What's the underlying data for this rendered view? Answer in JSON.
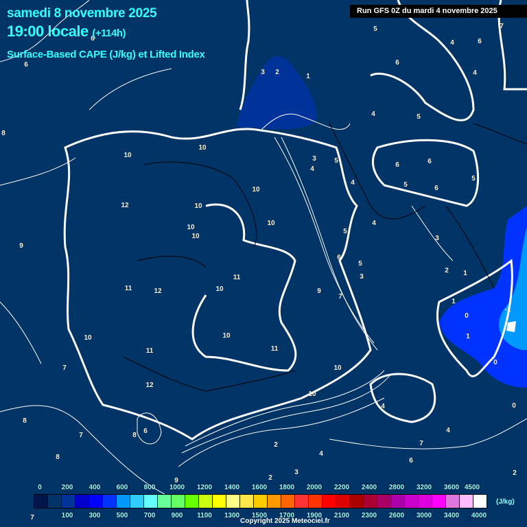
{
  "header": {
    "date": "samedi 8 novembre 2025",
    "time": "19:00 locale",
    "lead": "(+114h)",
    "title": "Surface-Based CAPE (J/kg) et Lifted Index",
    "run": "Run GFS 0Z du mardi 4 novembre 2025"
  },
  "legend": {
    "unit": "(J/kg)",
    "colors": [
      "#00164a",
      "#003366",
      "#003399",
      "#0000cc",
      "#0000ff",
      "#0033ff",
      "#0099ff",
      "#33ccff",
      "#66ffff",
      "#66ff99",
      "#66ff66",
      "#66ff00",
      "#ccff11",
      "#ffff00",
      "#ffff88",
      "#ffe64d",
      "#ffcc00",
      "#ff9900",
      "#ff6600",
      "#ff3333",
      "#ff3300",
      "#ff0000",
      "#dd0000",
      "#aa0000",
      "#aa0033",
      "#aa0066",
      "#aa00aa",
      "#cc00cc",
      "#dd00dd",
      "#ff00ff",
      "#dd77dd",
      "#ffbbff",
      "#ffffff"
    ],
    "top_labels": [
      "0",
      "200",
      "400",
      "600",
      "800",
      "1000",
      "1200",
      "1400",
      "1600",
      "1800",
      "2000",
      "2200",
      "2400",
      "2800",
      "3200",
      "3600",
      "4500"
    ],
    "bottom_labels": [
      "100",
      "300",
      "500",
      "700",
      "900",
      "1100",
      "1300",
      "1500",
      "1700",
      "1900",
      "2100",
      "2300",
      "2600",
      "3000",
      "3400",
      "4000"
    ]
  },
  "lifted_index_labels": [
    "6",
    "6",
    "8",
    "10",
    "10",
    "12",
    "10",
    "10",
    "10",
    "10",
    "10",
    "9",
    "11",
    "12",
    "11",
    "10",
    "10",
    "10",
    "11",
    "11",
    "7",
    "12",
    "10",
    "10",
    "8",
    "7",
    "8",
    "6",
    "8",
    "9",
    "2",
    "2",
    "3",
    "4",
    "6",
    "7",
    "4",
    "4",
    "0",
    "0",
    "1",
    "0",
    "1",
    "1",
    "-1",
    "2",
    "3",
    "4",
    "5",
    "6",
    "5",
    "3",
    "7",
    "9",
    "4",
    "5",
    "3",
    "4",
    "6",
    "6",
    "5",
    "6",
    "5",
    "4",
    "5",
    "6",
    "4",
    "4",
    "6",
    "7",
    "5",
    "3",
    "2",
    "1",
    "2",
    "7"
  ],
  "copyright": "Copyright 2025 Meteociel.fr"
}
